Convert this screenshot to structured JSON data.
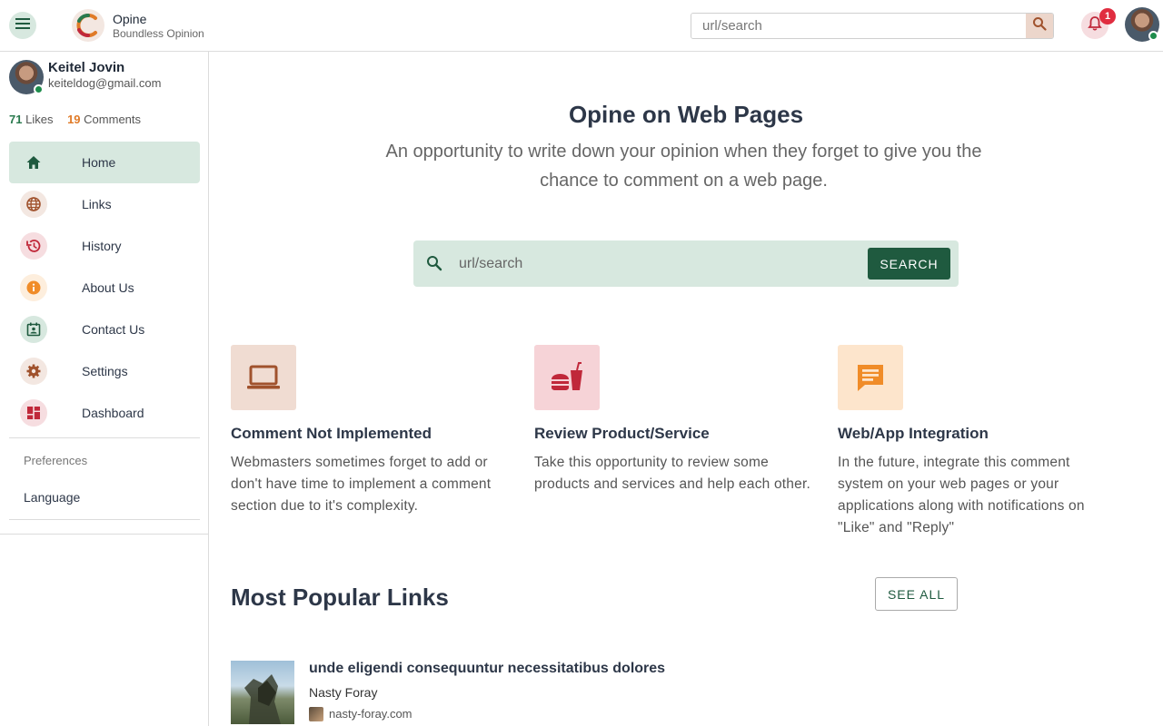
{
  "app": {
    "name": "Opine",
    "tagline": "Boundless Opinion"
  },
  "topbar": {
    "search_placeholder": "url/search",
    "notification_count": "1"
  },
  "user": {
    "name": "Keitel Jovin",
    "email": "keiteldog@gmail.com",
    "likes": "71",
    "likes_label": "Likes",
    "comments": "19",
    "comments_label": "Comments"
  },
  "nav": {
    "items": [
      {
        "label": "Home",
        "icon": "home-icon",
        "color": "#1f5a3f",
        "bg": "transparent"
      },
      {
        "label": "Links",
        "icon": "globe-icon",
        "color": "#a0522d",
        "bg": "#f3e7e1"
      },
      {
        "label": "History",
        "icon": "history-icon",
        "color": "#c0283a",
        "bg": "#f6dde0"
      },
      {
        "label": "About Us",
        "icon": "info-icon",
        "color": "#f08c28",
        "bg": "#fdeedd"
      },
      {
        "label": "Contact Us",
        "icon": "contact-calendar-icon",
        "color": "#1f5a3f",
        "bg": "#d7e8df"
      },
      {
        "label": "Settings",
        "icon": "gear-icon",
        "color": "#a0522d",
        "bg": "#f3e7e1"
      },
      {
        "label": "Dashboard",
        "icon": "dashboard-icon",
        "color": "#c0283a",
        "bg": "#f6dde0"
      }
    ],
    "preferences_label": "Preferences",
    "language_label": "Language"
  },
  "hero": {
    "title": "Opine on Web Pages",
    "subtitle": "An opportunity to write down your opinion when they forget to give you the chance to comment on a web page.",
    "search_placeholder": "url/search",
    "search_button": "SEARCH"
  },
  "features": [
    {
      "title": "Comment Not Implemented",
      "desc": "Webmasters sometimes forget to add or don't have time to implement a comment section due to it's complexity.",
      "icon": "laptop-icon",
      "color": "#a0522d",
      "bg": "#f0dcd2"
    },
    {
      "title": "Review Product/Service",
      "desc": "Take this opportunity to review some products and services and help each other.",
      "icon": "fastfood-icon",
      "color": "#c0283a",
      "bg": "#f6d3d7"
    },
    {
      "title": "Web/App Integration",
      "desc": "In the future, integrate this comment system on your web pages or your applications along with notifications on \"Like\" and \"Reply\"",
      "icon": "chat-icon",
      "color": "#f08c28",
      "bg": "#fde5cc"
    }
  ],
  "popular": {
    "title": "Most Popular Links",
    "see_all": "SEE ALL",
    "links": [
      {
        "title": "unde eligendi consequuntur necessitatibus dolores",
        "author": "Nasty Foray",
        "domain": "nasty-foray.com"
      }
    ]
  }
}
